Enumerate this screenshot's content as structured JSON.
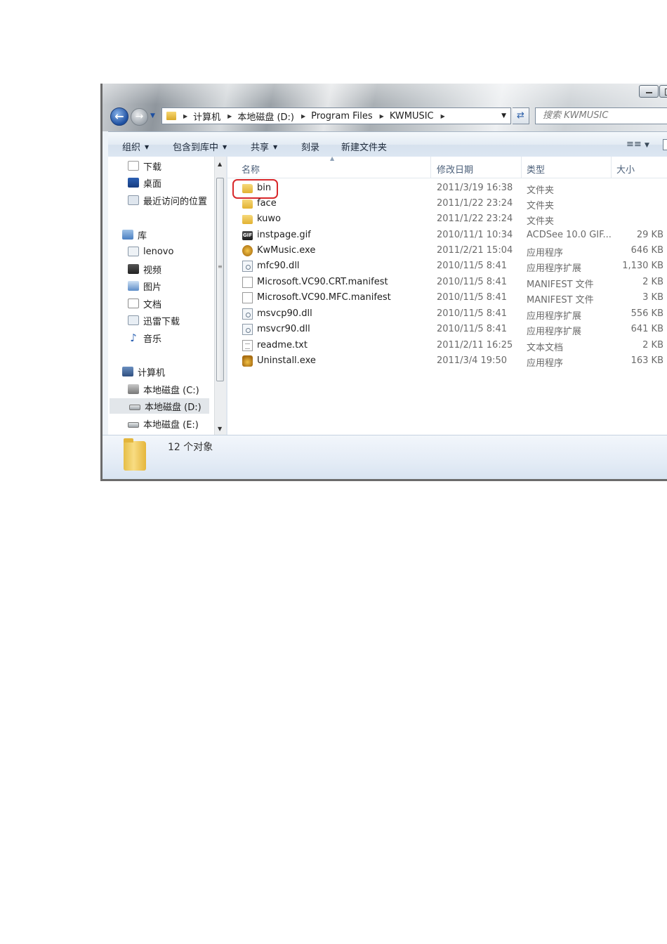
{
  "address_bar": {
    "crumbs": [
      "计算机",
      "本地磁盘 (D:)",
      "Program Files",
      "KWMUSIC"
    ],
    "search_placeholder": "搜索 KWMUSIC"
  },
  "command_bar": {
    "organize": "组织",
    "include_in_library": "包含到库中",
    "share": "共享",
    "burn": "刻录",
    "new_folder": "新建文件夹"
  },
  "nav_pane": {
    "favorites": [
      {
        "label": "下载",
        "icon": "download-folder-icon"
      },
      {
        "label": "桌面",
        "icon": "desktop-icon"
      },
      {
        "label": "最近访问的位置",
        "icon": "recent-places-icon"
      }
    ],
    "libraries_label": "库",
    "libraries": [
      {
        "label": "lenovo",
        "icon": "library-icon"
      },
      {
        "label": "视频",
        "icon": "video-icon"
      },
      {
        "label": "图片",
        "icon": "pictures-icon"
      },
      {
        "label": "文档",
        "icon": "documents-icon"
      },
      {
        "label": "迅雷下载",
        "icon": "thunder-download-icon"
      },
      {
        "label": "音乐",
        "icon": "music-icon"
      }
    ],
    "computer_label": "计算机",
    "drives": [
      {
        "label": "本地磁盘 (C:)",
        "icon": "system-drive-icon"
      },
      {
        "label": "本地磁盘 (D:)",
        "icon": "drive-icon",
        "selected": true
      },
      {
        "label": "本地磁盘 (E:)",
        "icon": "drive-icon"
      }
    ]
  },
  "columns": {
    "name": "名称",
    "date": "修改日期",
    "type": "类型",
    "size": "大小"
  },
  "files": [
    {
      "name": "bin",
      "date": "2011/3/19 16:38",
      "type": "文件夹",
      "size": "",
      "icon": "folder-icon"
    },
    {
      "name": "face",
      "date": "2011/1/22 23:24",
      "type": "文件夹",
      "size": "",
      "icon": "folder-icon"
    },
    {
      "name": "kuwo",
      "date": "2011/1/22 23:24",
      "type": "文件夹",
      "size": "",
      "icon": "folder-icon"
    },
    {
      "name": "instpage.gif",
      "date": "2010/11/1 10:34",
      "type": "ACDSee 10.0 GIF...",
      "size": "29 KB",
      "icon": "gif-file-icon"
    },
    {
      "name": "KwMusic.exe",
      "date": "2011/2/21 15:04",
      "type": "应用程序",
      "size": "646 KB",
      "icon": "exe-file-icon"
    },
    {
      "name": "mfc90.dll",
      "date": "2010/11/5 8:41",
      "type": "应用程序扩展",
      "size": "1,130 KB",
      "icon": "dll-file-icon"
    },
    {
      "name": "Microsoft.VC90.CRT.manifest",
      "date": "2010/11/5 8:41",
      "type": "MANIFEST 文件",
      "size": "2 KB",
      "icon": "manifest-file-icon"
    },
    {
      "name": "Microsoft.VC90.MFC.manifest",
      "date": "2010/11/5 8:41",
      "type": "MANIFEST 文件",
      "size": "3 KB",
      "icon": "manifest-file-icon"
    },
    {
      "name": "msvcp90.dll",
      "date": "2010/11/5 8:41",
      "type": "应用程序扩展",
      "size": "556 KB",
      "icon": "dll-file-icon"
    },
    {
      "name": "msvcr90.dll",
      "date": "2010/11/5 8:41",
      "type": "应用程序扩展",
      "size": "641 KB",
      "icon": "dll-file-icon"
    },
    {
      "name": "readme.txt",
      "date": "2011/2/11 16:25",
      "type": "文本文档",
      "size": "2 KB",
      "icon": "text-file-icon"
    },
    {
      "name": "Uninstall.exe",
      "date": "2011/3/4 19:50",
      "type": "应用程序",
      "size": "163 KB",
      "icon": "uninstall-exe-icon"
    }
  ],
  "status": {
    "object_count": "12 个对象"
  },
  "colors": {
    "highlight_ring": "#d8282b",
    "command_bar": "#dde7f2"
  }
}
